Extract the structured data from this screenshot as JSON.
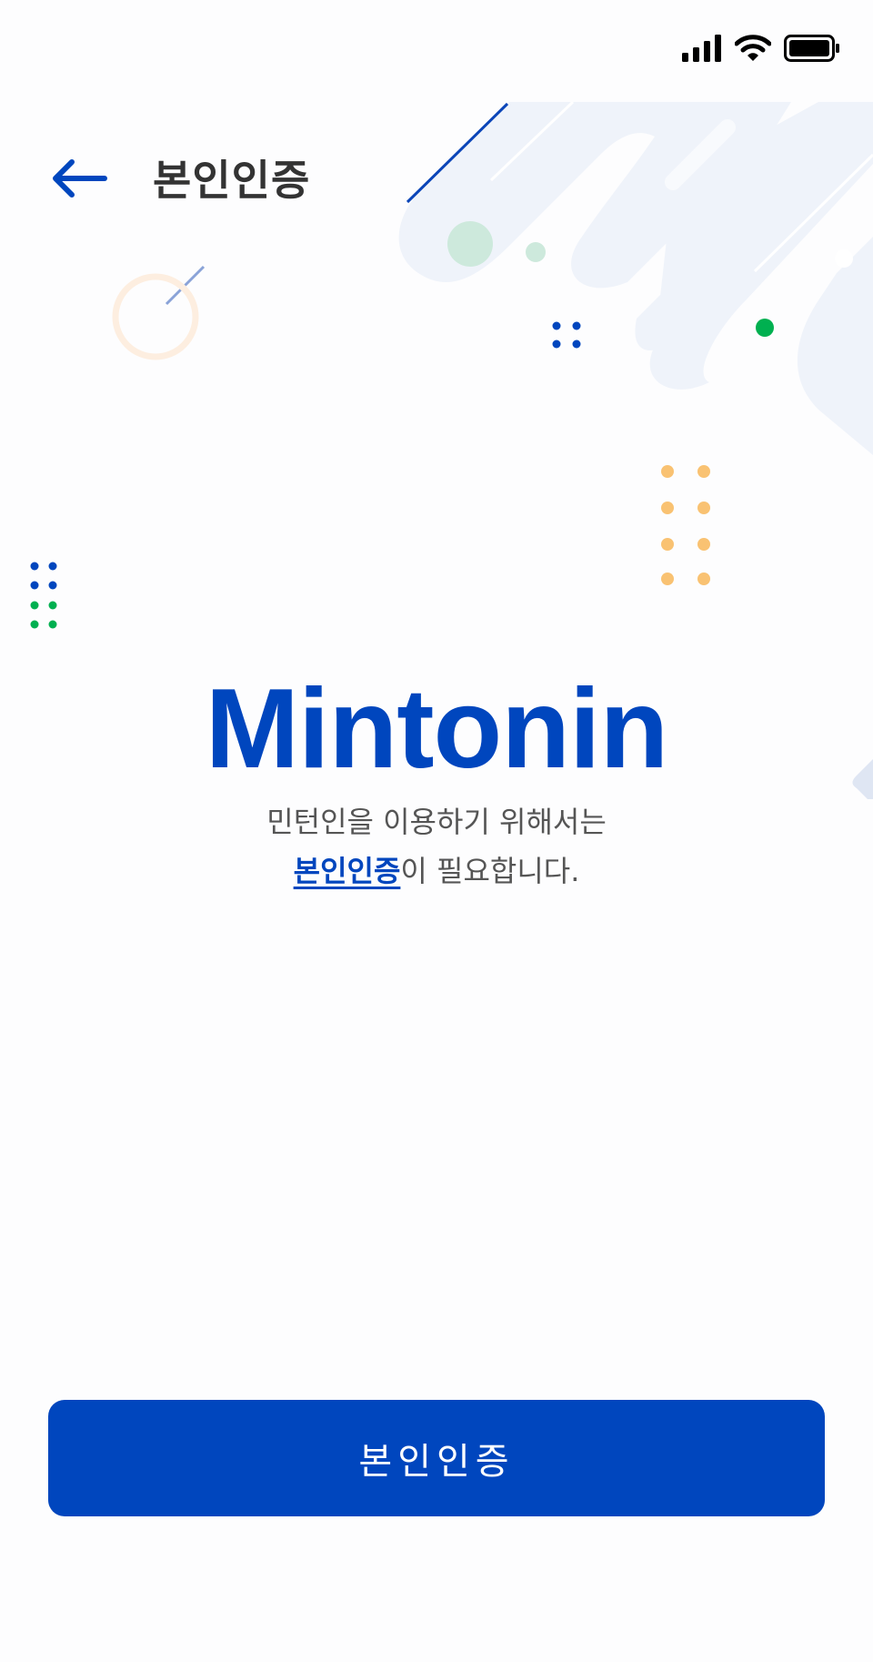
{
  "header": {
    "title": "본인인증",
    "back_icon": "arrow-left-icon"
  },
  "status_bar": {
    "icons": [
      "signal-icon",
      "wifi-icon",
      "battery-icon"
    ]
  },
  "main": {
    "brand": "Mintonin",
    "description_line1": "민턴인을 이용하기 위해서는",
    "description_highlight": "본인인증",
    "description_line2_rest": "이 필요합니다."
  },
  "cta": {
    "label": "본인인증"
  },
  "colors": {
    "accent": "#0046be",
    "green": "#00b050",
    "orange": "#f9c272",
    "text": "#333333"
  }
}
